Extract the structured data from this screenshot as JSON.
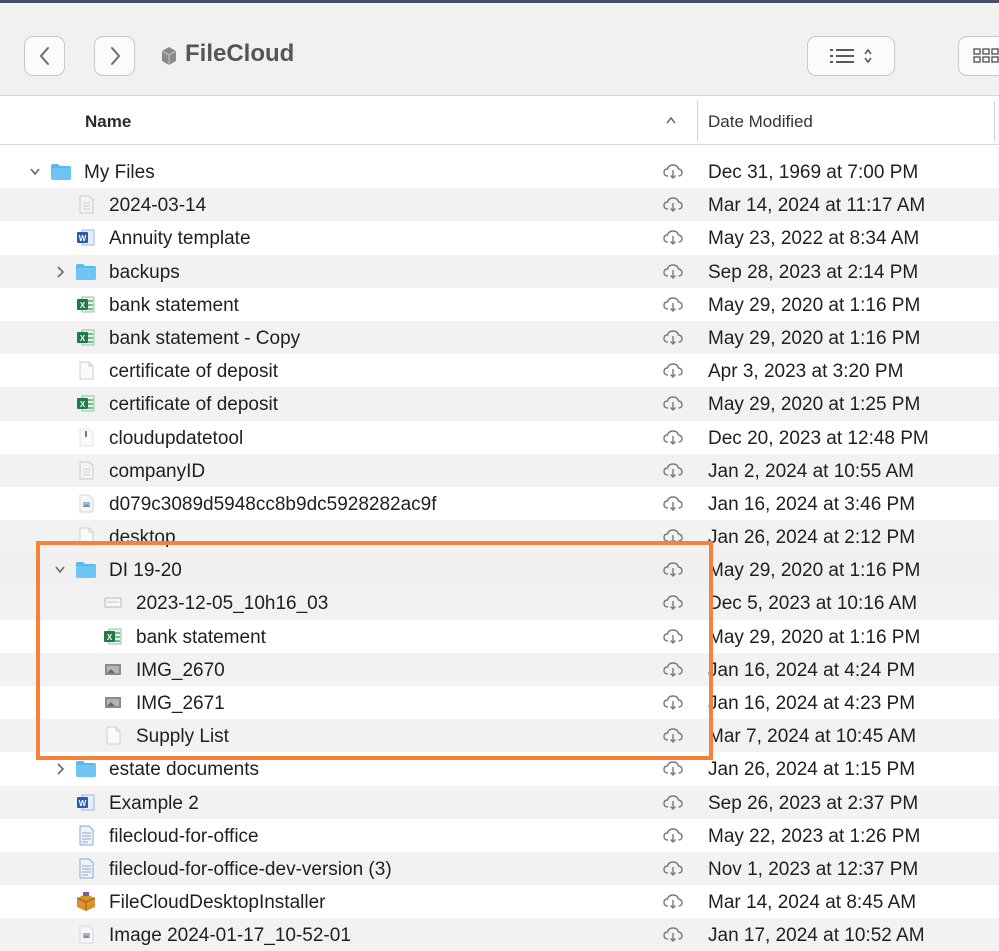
{
  "window": {
    "title": "FileCloud",
    "back_icon": "chevron-left-icon",
    "forward_icon": "chevron-right-icon",
    "view_list_icon": "list-view-icon",
    "view_grid_icon": "grid-view-icon"
  },
  "columns": {
    "name": "Name",
    "date_modified": "Date Modified"
  },
  "colors": {
    "highlight": "#f4823a",
    "folder": "#5bb8ec",
    "excel": "#1f7a45",
    "word": "#2b5cab"
  },
  "rows": [
    {
      "name": "My Files",
      "date": "Dec 31, 1969 at 7:00 PM",
      "icon": "folder-icon",
      "expand": "expanded"
    },
    {
      "name": "2024-03-14",
      "date": "Mar 14, 2024 at 11:17 AM",
      "icon": "document-icon"
    },
    {
      "name": "Annuity template",
      "date": "May 23, 2022 at 8:34 AM",
      "icon": "word-doc-icon"
    },
    {
      "name": "backups",
      "date": "Sep 28, 2023 at 2:14 PM",
      "icon": "folder-icon",
      "expand": "collapsed"
    },
    {
      "name": "bank statement",
      "date": "May 29, 2020 at 1:16 PM",
      "icon": "excel-doc-icon"
    },
    {
      "name": "bank statement - Copy",
      "date": "May 29, 2020 at 1:16 PM",
      "icon": "excel-doc-icon"
    },
    {
      "name": "certificate of deposit",
      "date": "Apr 3, 2023 at 3:20 PM",
      "icon": "blank-file-icon"
    },
    {
      "name": "certificate of deposit",
      "date": "May 29, 2020 at 1:25 PM",
      "icon": "excel-doc-icon"
    },
    {
      "name": "cloudupdatetool",
      "date": "Dec 20, 2023 at 12:48 PM",
      "icon": "executable-file-icon"
    },
    {
      "name": "companyID",
      "date": "Jan 2, 2024 at 10:55 AM",
      "icon": "document-icon"
    },
    {
      "name": "d079c3089d5948cc8b9dc5928282ac9f",
      "date": "Jan 16, 2024 at 3:46 PM",
      "icon": "image-file-icon"
    },
    {
      "name": "desktop",
      "date": "Jan 26, 2024 at 2:12 PM",
      "icon": "blank-file-icon"
    },
    {
      "name": "DI 19-20",
      "date": "May 29, 2020 at 1:16 PM",
      "icon": "folder-icon",
      "expand": "expanded"
    },
    {
      "name": "2023-12-05_10h16_03",
      "date": "Dec 5, 2023 at 10:16 AM",
      "icon": "screenshot-file-icon"
    },
    {
      "name": "bank statement",
      "date": "May 29, 2020 at 1:16 PM",
      "icon": "excel-doc-icon"
    },
    {
      "name": "IMG_2670",
      "date": "Jan 16, 2024 at 4:24 PM",
      "icon": "photo-file-icon"
    },
    {
      "name": "IMG_2671",
      "date": "Jan 16, 2024 at 4:23 PM",
      "icon": "photo-file-icon"
    },
    {
      "name": "Supply List",
      "date": "Mar 7, 2024 at 10:45 AM",
      "icon": "blank-file-icon"
    },
    {
      "name": "estate documents",
      "date": "Jan 26, 2024 at 1:15 PM",
      "icon": "folder-icon",
      "expand": "collapsed"
    },
    {
      "name": "Example 2",
      "date": "Sep 26, 2023 at 2:37 PM",
      "icon": "word-doc-icon"
    },
    {
      "name": "filecloud-for-office",
      "date": "May 22, 2023 at 1:26 PM",
      "icon": "text-document-icon"
    },
    {
      "name": "filecloud-for-office-dev-version (3)",
      "date": "Nov 1, 2023 at 12:37 PM",
      "icon": "text-document-icon"
    },
    {
      "name": "FileCloudDesktopInstaller",
      "date": "Mar 14, 2024 at 8:45 AM",
      "icon": "package-icon"
    },
    {
      "name": "Image 2024-01-17_10-52-01",
      "date": "Jan 17, 2024 at 10:52 AM",
      "icon": "image-file-icon"
    }
  ]
}
